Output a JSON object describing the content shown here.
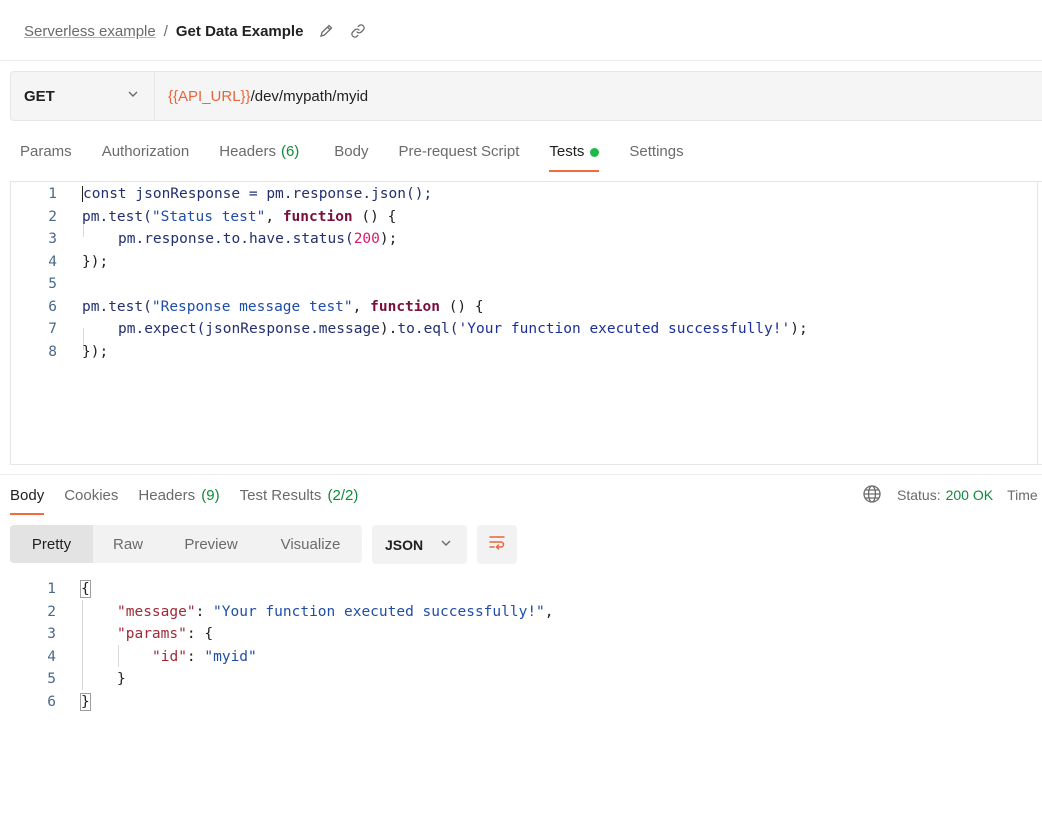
{
  "breadcrumb": {
    "parent": "Serverless example",
    "separator": "/",
    "current": "Get Data Example"
  },
  "icons": {
    "edit": "pencil-icon",
    "link": "link-icon",
    "method_dropdown": "chevron-down-icon",
    "globe": "globe-icon",
    "wrap": "wrap-lines-icon"
  },
  "request": {
    "method": "GET",
    "url_variable": "{{API_URL}}",
    "url_path": "/dev/mypath/myid"
  },
  "request_tabs": [
    {
      "label": "Params",
      "count": ""
    },
    {
      "label": "Authorization",
      "count": ""
    },
    {
      "label": "Headers",
      "count": "(6)"
    },
    {
      "label": "Body",
      "count": ""
    },
    {
      "label": "Pre-request Script",
      "count": ""
    },
    {
      "label": "Tests",
      "count": ""
    },
    {
      "label": "Settings",
      "count": ""
    }
  ],
  "active_request_tab": "Tests",
  "tests_editor": {
    "line_numbers": [
      "1",
      "2",
      "3",
      "4",
      "5",
      "6",
      "7",
      "8"
    ],
    "l1": {
      "a": "const jsonResponse = pm.response.json();"
    },
    "l2": {
      "a": "pm",
      "b": ".test(",
      "c": "\"Status test\"",
      "d": ", ",
      "e": "function",
      "f": " () {"
    },
    "l3": {
      "a": "pm.response.to.have.status(",
      "b": "200",
      "c": ");"
    },
    "l4": {
      "a": "});"
    },
    "l6": {
      "a": "pm",
      "b": ".test(",
      "c": "\"Response message test\"",
      "d": ", ",
      "e": "function",
      "f": " () {"
    },
    "l7": {
      "a": "pm",
      "b": ".expect(jsonResponse.",
      "c": "message",
      "d": ").",
      "e": "to",
      "f": ".eql(",
      "g": "'Your function executed successfully!'",
      "h": ");"
    },
    "l8": {
      "a": "});"
    }
  },
  "response_tabs": [
    {
      "label": "Body",
      "count": ""
    },
    {
      "label": "Cookies",
      "count": ""
    },
    {
      "label": "Headers",
      "count": "(9)"
    },
    {
      "label": "Test Results",
      "count": "(2/2)"
    }
  ],
  "status": {
    "label": "Status:",
    "value": "200 OK",
    "time_label": "Time"
  },
  "view_modes": [
    "Pretty",
    "Raw",
    "Preview",
    "Visualize"
  ],
  "active_view_mode": "Pretty",
  "format": "JSON",
  "response_body": {
    "line_numbers": [
      "1",
      "2",
      "3",
      "4",
      "5",
      "6"
    ],
    "open_brace": "{",
    "message_key": "\"message\"",
    "message_value": "\"Your function executed successfully!\"",
    "params_key": "\"params\"",
    "id_key": "\"id\"",
    "id_value": "\"myid\"",
    "inner_close": "}",
    "close_brace": "}",
    "colon": ": ",
    "comma": ",",
    "open_inner": "{"
  },
  "colors": {
    "accent": "#f26b3a",
    "url_variable": "#e8663d",
    "success": "#0f8a3c",
    "dot": "#1fb94a"
  }
}
